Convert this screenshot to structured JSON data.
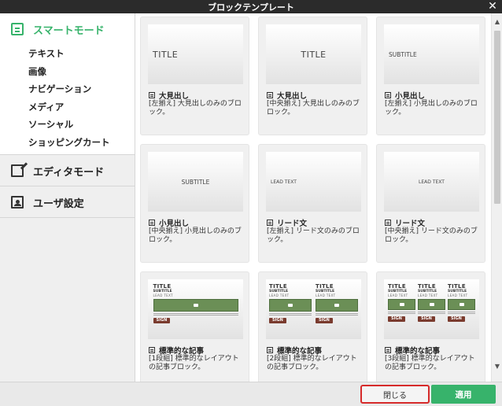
{
  "window": {
    "title": "ブロックテンプレート",
    "close_symbol": "✕"
  },
  "sidebar": {
    "modes": [
      {
        "label": "スマートモード",
        "icon": "list-icon",
        "active": true
      },
      {
        "label": "エディタモード",
        "icon": "edit-icon",
        "active": false
      },
      {
        "label": "ユーザ設定",
        "icon": "user-icon",
        "active": false
      }
    ],
    "smart_items": [
      "テキスト",
      "画像",
      "ナビゲーション",
      "メディア",
      "ソーシャル",
      "ショッピングカート"
    ]
  },
  "cards": [
    {
      "thumb_text": "TITLE",
      "name": "大見出し",
      "desc": "[左揃え] 大見出しのみのブロック。"
    },
    {
      "thumb_text": "TITLE",
      "name": "大見出し",
      "desc": "[中央揃え] 大見出しのみのブロック。"
    },
    {
      "thumb_text": "SUBTITLE",
      "name": "小見出し",
      "desc": "[左揃え] 小見出しのみのブロック。"
    },
    {
      "thumb_text": "SUBTITLE",
      "name": "小見出し",
      "desc": "[中央揃え] 小見出しのみのブロック。"
    },
    {
      "thumb_text": "LEAD TEXT",
      "name": "リード文",
      "desc": "[左揃え] リード文のみのブロック。"
    },
    {
      "thumb_text": "LEAD TEXT",
      "name": "リード文",
      "desc": "[中央揃え] リード文のみのブロック。"
    },
    {
      "name": "標準的な記事",
      "desc": "[1段組] 標準的なレイアウトの記事ブロック。"
    },
    {
      "name": "標準的な記事",
      "desc": "[2段組] 標準的なレイアウトの記事ブロック。"
    },
    {
      "name": "標準的な記事",
      "desc": "[3段組] 標準的なレイアウトの記事ブロック。"
    }
  ],
  "article_art": {
    "title": "TITLE",
    "subtitle": "SUBTITLE",
    "lead": "LEAD TEXT",
    "button": "SIGN"
  },
  "footer": {
    "close_label": "閉じる",
    "apply_label": "適用"
  },
  "colors": {
    "accent": "#37b36b",
    "highlight": "#d62a2a",
    "titlebar": "#2b2b2b"
  }
}
